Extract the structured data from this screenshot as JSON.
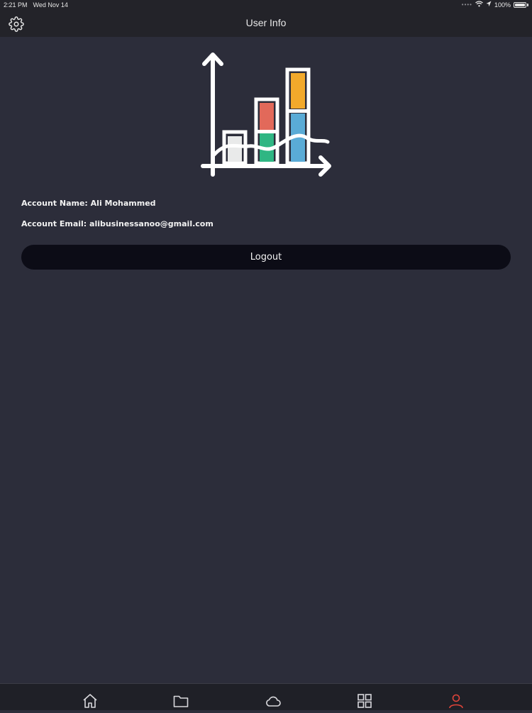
{
  "status_bar": {
    "time": "2:21 PM",
    "date": "Wed Nov 14",
    "battery": "100%",
    "icons": [
      "wifi-icon",
      "location-icon",
      "battery-icon"
    ]
  },
  "header": {
    "title": "User Info",
    "settings_icon": "gear-icon"
  },
  "hero": {
    "icon": "bar-chart-icon",
    "colors": {
      "red": "#e2695a",
      "green": "#2fb683",
      "orange": "#f2a92b",
      "blue": "#5aabd6",
      "light": "#e9eaea"
    }
  },
  "account": {
    "name_label": "Account Name:",
    "name_value": "Ali Mohammed",
    "email_label": "Account Email:",
    "email_value": "alibusinessanoo@gmail.com"
  },
  "actions": {
    "logout_label": "Logout"
  },
  "tab_bar": {
    "tabs": [
      {
        "icon": "home-icon",
        "active": false
      },
      {
        "icon": "folder-icon",
        "active": false
      },
      {
        "icon": "cloud-icon",
        "active": false
      },
      {
        "icon": "grid-icon",
        "active": false
      },
      {
        "icon": "user-icon",
        "active": true
      }
    ],
    "active_color": "#e0443a",
    "inactive_color": "#d8d8dc"
  },
  "theme": {
    "background": "#2c2d3a",
    "bar_background": "#232329",
    "button_background": "#0c0c16"
  }
}
